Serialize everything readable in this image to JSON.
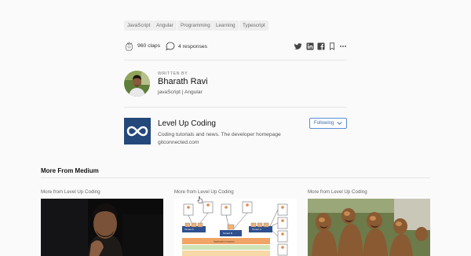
{
  "tags": [
    "JavaScript",
    "Angular",
    "Programming",
    "Learning",
    "Typescript"
  ],
  "stats": {
    "claps": "960 claps",
    "responses": "4 responses"
  },
  "share_icons": [
    "twitter-icon",
    "linkedin-icon",
    "facebook-icon",
    "bookmark-icon",
    "more-icon"
  ],
  "author": {
    "written_by": "WRITTEN BY",
    "name": "Bharath Ravi",
    "bio": "javaScript | Angular"
  },
  "publication": {
    "name": "Level Up Coding",
    "description": "Coding tutorials and news. The developer homepage",
    "url": "gitconnected.com",
    "follow_label": "Following",
    "logo_color": "#24487a"
  },
  "more_section": {
    "title": "More From Medium",
    "cards": [
      {
        "label": "More from Level Up Coding"
      },
      {
        "label": "More from Level Up Coding"
      },
      {
        "label": "More from Level Up Coding"
      }
    ],
    "diagram_labels": [
      "Tenant A",
      "Tenant B",
      "Tenant C",
      "Application Instance"
    ]
  },
  "colors": {
    "accent": "#3b6cb4",
    "background": "#fbfafb"
  }
}
